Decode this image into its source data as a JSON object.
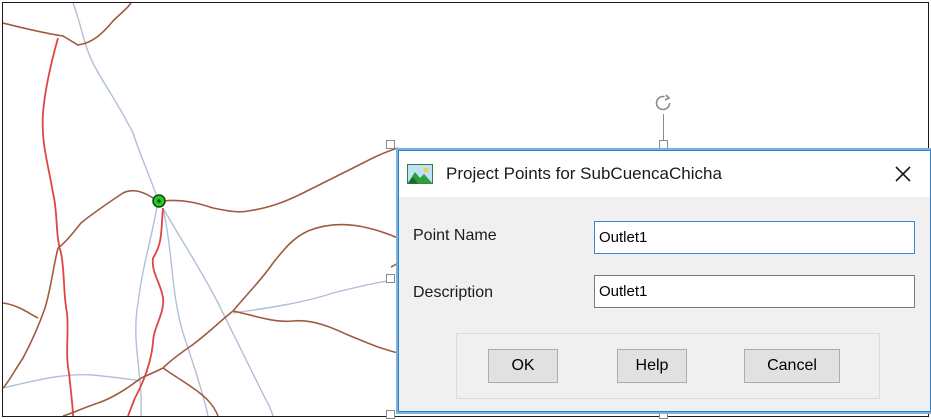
{
  "dialog": {
    "title": "Project Points for SubCuencaChicha",
    "close_glyph": "✕",
    "app_icon": "landscape-icon",
    "fields": {
      "point_name": {
        "label": "Point Name",
        "value": "Outlet1"
      },
      "description": {
        "label": "Description",
        "value": "Outlet1"
      }
    },
    "buttons": {
      "ok": "OK",
      "help": "Help",
      "cancel": "Cancel"
    }
  },
  "map": {
    "outlet_marker_color": "#22cc22",
    "watershed_boundary_color": "#e04545",
    "stream_color": "#b0c0d8",
    "subbasin_line_color": "#a05a40",
    "selection_handle_icon": "rotate-icon"
  },
  "colors": {
    "dialog_border": "#2f7fc6",
    "dialog_bg": "#f0f0f0",
    "input_focus_border": "#3b86d0"
  }
}
